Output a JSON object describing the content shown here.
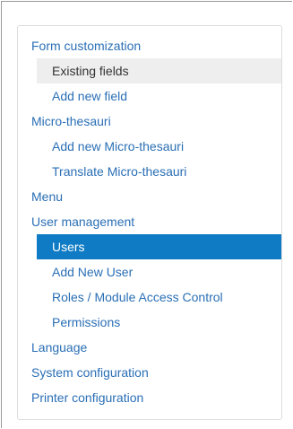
{
  "menu": {
    "items": [
      {
        "label": "Form customization"
      },
      {
        "label": "Existing fields"
      },
      {
        "label": "Add new field"
      },
      {
        "label": "Micro-thesauri"
      },
      {
        "label": "Add new Micro-thesauri"
      },
      {
        "label": "Translate Micro-thesauri"
      },
      {
        "label": "Menu"
      },
      {
        "label": "User management"
      },
      {
        "label": "Users"
      },
      {
        "label": "Add New User"
      },
      {
        "label": "Roles / Module Access Control"
      },
      {
        "label": "Permissions"
      },
      {
        "label": "Language"
      },
      {
        "label": "System configuration"
      },
      {
        "label": "Printer configuration"
      }
    ]
  },
  "colors": {
    "link": "#2a6fb5",
    "active_bg": "#0e7bc4",
    "active_text": "#ffffff",
    "hover_bg": "#eeeeee"
  }
}
